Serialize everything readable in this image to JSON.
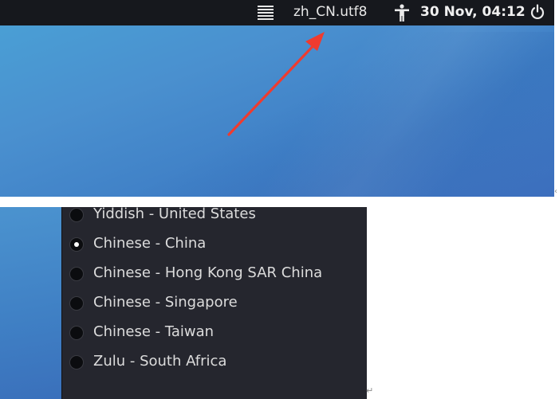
{
  "topbar": {
    "locale_indicator": "zh_CN.utf8",
    "datetime": "30 Nov, 04:12",
    "icons": [
      "menu-icon",
      "accessibility-icon",
      "power-icon"
    ]
  },
  "annotation": {
    "arrow_color": "#ef3b2f"
  },
  "locale_menu": {
    "items": [
      {
        "label": "Yiddish - United States",
        "selected": false
      },
      {
        "label": "Chinese - China",
        "selected": true
      },
      {
        "label": "Chinese - Hong Kong SAR China",
        "selected": false
      },
      {
        "label": "Chinese - Singapore",
        "selected": false
      },
      {
        "label": "Chinese - Taiwan",
        "selected": false
      },
      {
        "label": "Zulu - South Africa",
        "selected": false
      }
    ]
  },
  "colors": {
    "topbar_bg": "#16181d",
    "menu_bg": "#25262e",
    "desktop_blue": "#4a8fcf"
  }
}
